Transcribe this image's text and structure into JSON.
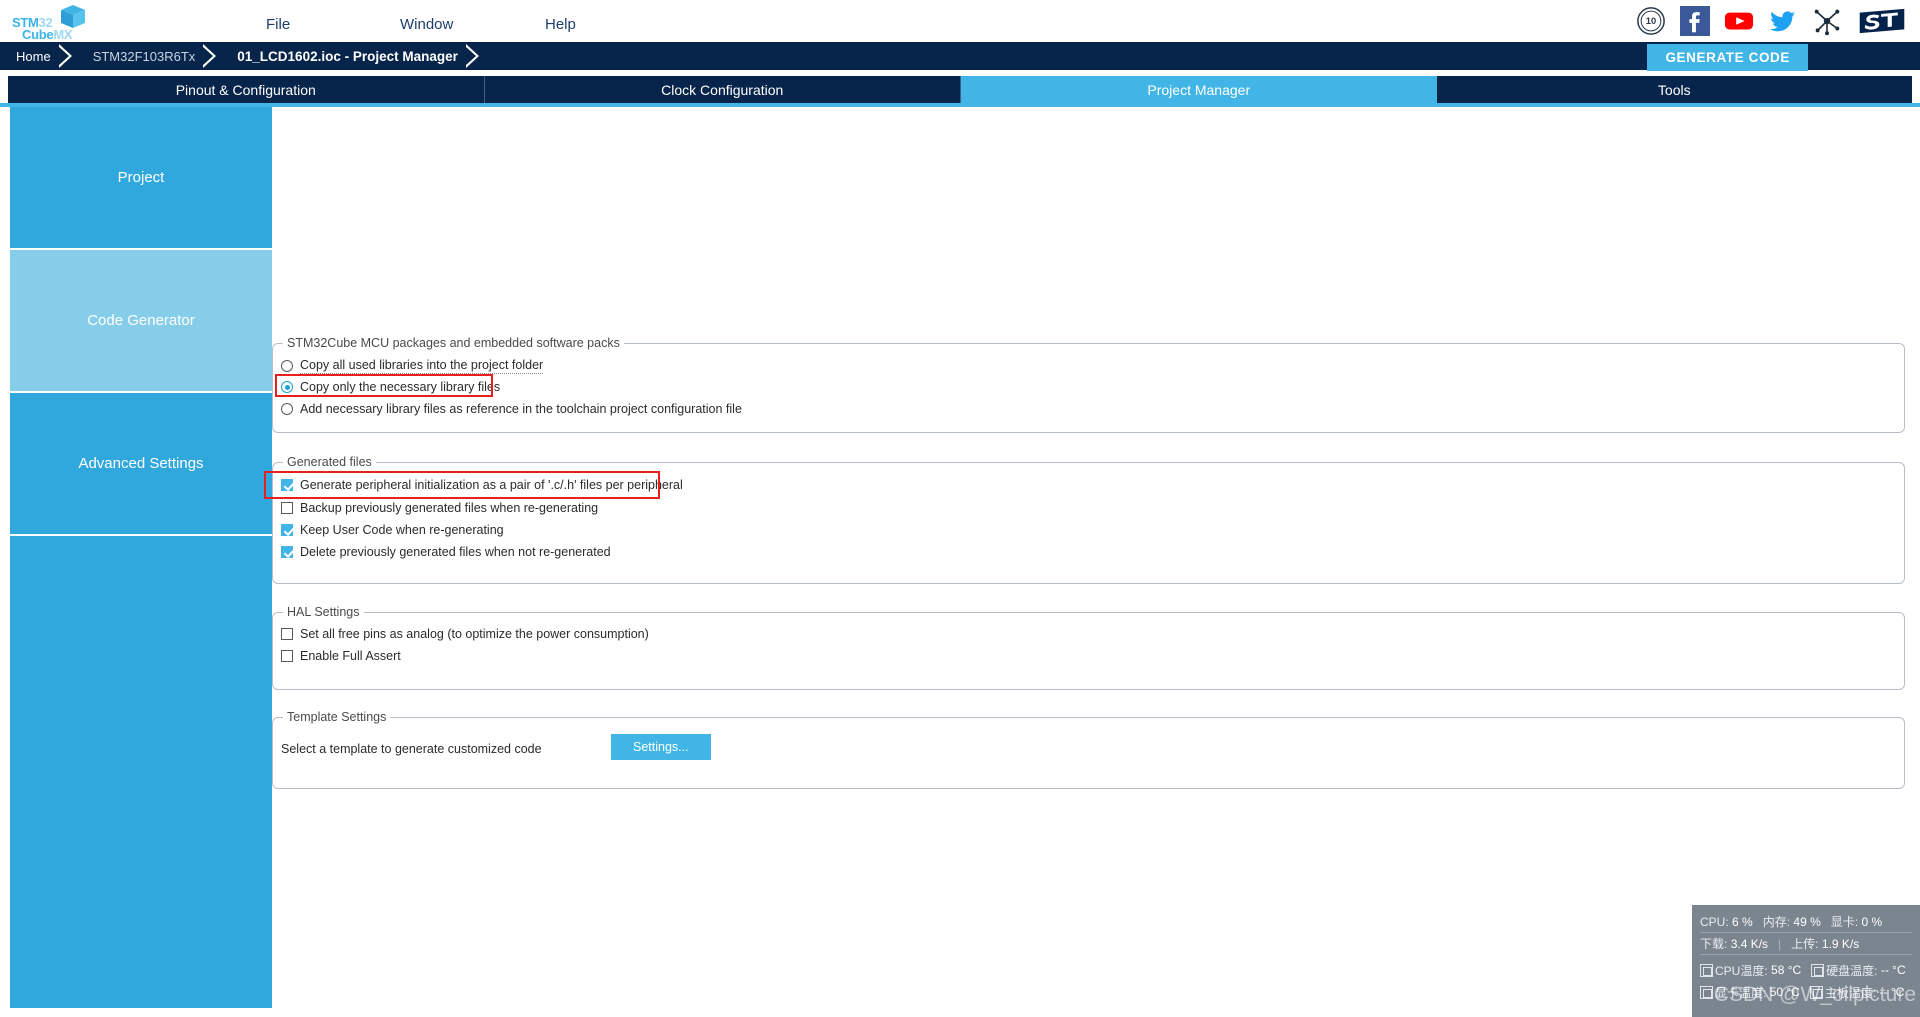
{
  "app": {
    "logo_line1_a": "STM",
    "logo_line1_b": "32",
    "logo_line2_a": "Cube",
    "logo_line2_b": "MX"
  },
  "menubar": {
    "items": [
      {
        "label": "File",
        "name": "menu-file"
      },
      {
        "label": "Window",
        "name": "menu-window"
      },
      {
        "label": "Help",
        "name": "menu-help"
      }
    ],
    "social_icons": [
      "ten-years-badge-icon",
      "facebook-icon",
      "youtube-icon",
      "twitter-icon",
      "community-network-icon",
      "st-logo-icon"
    ]
  },
  "breadcrumb": {
    "items": [
      {
        "label": "Home"
      },
      {
        "label": "STM32F103R6Tx"
      },
      {
        "label": "01_LCD1602.ioc - Project Manager"
      }
    ],
    "generate_code_label": "GENERATE CODE"
  },
  "tabs": [
    {
      "label": "Pinout & Configuration",
      "selected": false
    },
    {
      "label": "Clock Configuration",
      "selected": false
    },
    {
      "label": "Project Manager",
      "selected": true
    },
    {
      "label": "Tools",
      "selected": false
    }
  ],
  "sidebar": {
    "items": [
      {
        "label": "Project",
        "selected": false
      },
      {
        "label": "Code Generator",
        "selected": true
      },
      {
        "label": "Advanced Settings",
        "selected": false
      },
      {
        "label": "",
        "selected": false
      }
    ]
  },
  "groups": {
    "mcu_packages": {
      "title": "STM32Cube MCU packages and embedded software packs",
      "options": [
        {
          "label": "Copy all used libraries into the project folder",
          "checked": false,
          "focused": true
        },
        {
          "label": "Copy only the necessary library files",
          "checked": true,
          "focused": false,
          "highlighted": true
        },
        {
          "label": "Add necessary library files as reference in the toolchain project configuration file",
          "checked": false,
          "focused": false
        }
      ]
    },
    "generated_files": {
      "title": "Generated files",
      "options": [
        {
          "label": "Generate peripheral initialization as a pair of '.c/.h' files per peripheral",
          "checked": true,
          "highlighted": true
        },
        {
          "label": "Backup previously generated files when re-generating",
          "checked": false
        },
        {
          "label": "Keep User Code when re-generating",
          "checked": true
        },
        {
          "label": "Delete previously generated files when not re-generated",
          "checked": true
        }
      ]
    },
    "hal_settings": {
      "title": "HAL Settings",
      "options": [
        {
          "label": "Set all free pins as analog (to optimize the power consumption)",
          "checked": false
        },
        {
          "label": "Enable Full Assert",
          "checked": false
        }
      ]
    },
    "template_settings": {
      "title": "Template Settings",
      "description": "Select a template to generate customized code",
      "settings_button": "Settings..."
    }
  },
  "system_monitor": {
    "cpu_label": "CPU:",
    "cpu_value": "6 %",
    "mem_label": "内存:",
    "mem_value": "49 %",
    "gpu_label": "显卡:",
    "gpu_value": "0 %",
    "down_label": "下载:",
    "down_value": "3.4 K/s",
    "up_label": "上传:",
    "up_value": "1.9 K/s",
    "cpu_temp_label": "CPU温度:",
    "cpu_temp_value": "58 °C",
    "hdd_temp_label": "硬盘温度:",
    "hdd_temp_value": "-- °C",
    "gpu_temp_label": "显卡温度:",
    "gpu_temp_value": "50 °C",
    "mb_temp_label": "主板温度:",
    "mb_temp_value": "-- °C"
  },
  "watermark": "CSDN @W_oilpicture",
  "colors": {
    "accent": "#41b6e6",
    "navy": "#07244a",
    "sidebar": "#31a8dd",
    "sidebar_selected": "#86cdea",
    "highlight_red": "#e81f1f"
  }
}
